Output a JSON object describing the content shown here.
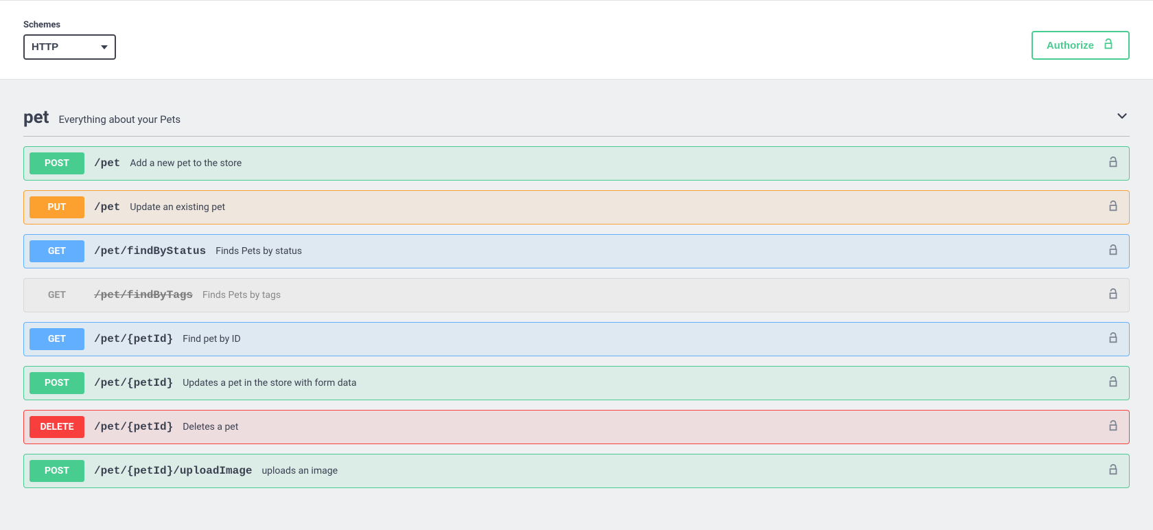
{
  "schemes": {
    "label": "Schemes",
    "selected": "HTTP"
  },
  "authorize": {
    "label": "Authorize"
  },
  "tag": {
    "name": "pet",
    "description": "Everything about your Pets"
  },
  "operations": [
    {
      "method": "POST",
      "css": "post",
      "path": "/pet",
      "summary": "Add a new pet to the store"
    },
    {
      "method": "PUT",
      "css": "put",
      "path": "/pet",
      "summary": "Update an existing pet"
    },
    {
      "method": "GET",
      "css": "get",
      "path": "/pet/findByStatus",
      "summary": "Finds Pets by status"
    },
    {
      "method": "GET",
      "css": "deprecated",
      "path": "/pet/findByTags",
      "summary": "Finds Pets by tags"
    },
    {
      "method": "GET",
      "css": "get",
      "path": "/pet/{petId}",
      "summary": "Find pet by ID"
    },
    {
      "method": "POST",
      "css": "post",
      "path": "/pet/{petId}",
      "summary": "Updates a pet in the store with form data"
    },
    {
      "method": "DELETE",
      "css": "delete",
      "path": "/pet/{petId}",
      "summary": "Deletes a pet"
    },
    {
      "method": "POST",
      "css": "post",
      "path": "/pet/{petId}/uploadImage",
      "summary": "uploads an image"
    }
  ]
}
